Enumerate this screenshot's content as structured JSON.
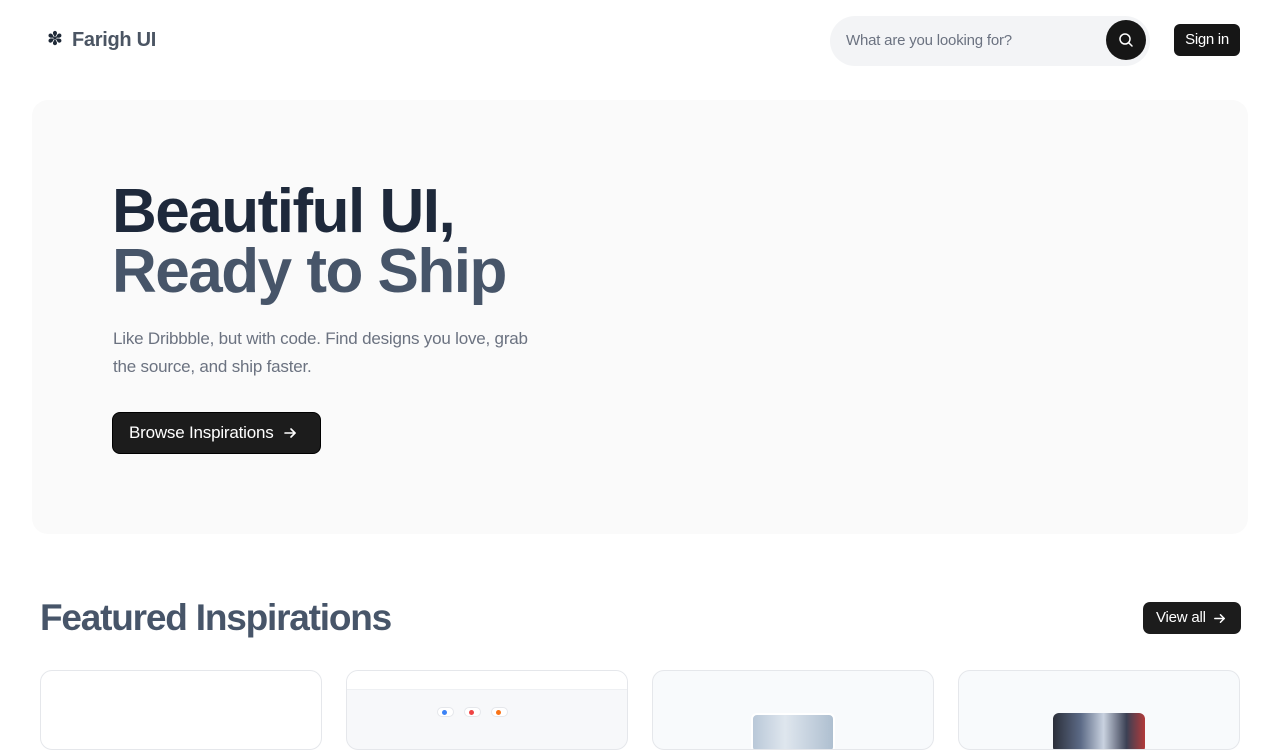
{
  "header": {
    "logo_mark": "✽",
    "logo_text": "Farigh UI",
    "search_placeholder": "What are you looking for?",
    "search_icon": "search-icon",
    "signin_label": "Sign in"
  },
  "hero": {
    "title_line1": "Beautiful UI,",
    "title_line2": "Ready to Ship",
    "description": "Like Dribbble, but with code. Find designs you love, grab the source, and ship faster.",
    "cta_label": "Browse Inspirations",
    "cta_icon": "arrow-right-icon"
  },
  "featured": {
    "title": "Featured Inspirations",
    "view_all_label": "View all",
    "view_all_icon": "arrow-right-icon",
    "cards": [
      {
        "preview": "blank"
      },
      {
        "preview": "site-preview"
      },
      {
        "preview": "image-preview"
      },
      {
        "preview": "image-preview"
      }
    ]
  },
  "colors": {
    "accent_dark": "#161616",
    "hero_bg": "#fafafa",
    "title_dark": "#1e293b",
    "title_slate": "#475569",
    "muted_text": "#6b7280"
  }
}
